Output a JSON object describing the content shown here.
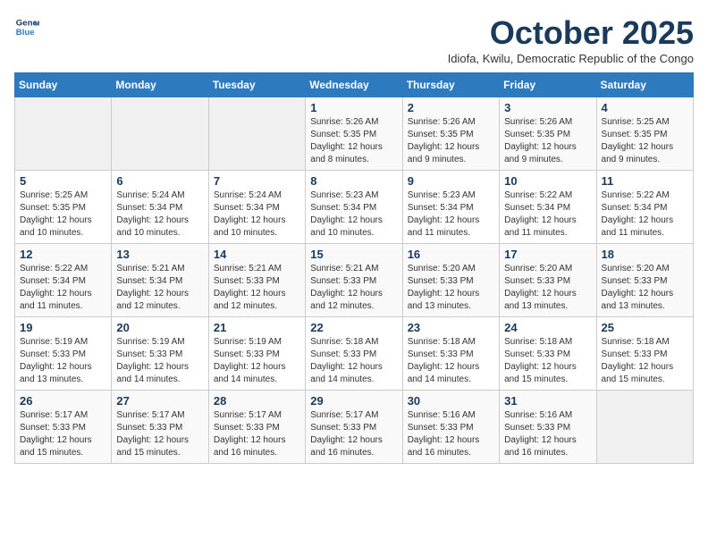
{
  "header": {
    "logo_line1": "General",
    "logo_line2": "Blue",
    "month_title": "October 2025",
    "subtitle": "Idiofa, Kwilu, Democratic Republic of the Congo"
  },
  "weekdays": [
    "Sunday",
    "Monday",
    "Tuesday",
    "Wednesday",
    "Thursday",
    "Friday",
    "Saturday"
  ],
  "weeks": [
    [
      {
        "day": "",
        "info": ""
      },
      {
        "day": "",
        "info": ""
      },
      {
        "day": "",
        "info": ""
      },
      {
        "day": "1",
        "info": "Sunrise: 5:26 AM\nSunset: 5:35 PM\nDaylight: 12 hours and 8 minutes."
      },
      {
        "day": "2",
        "info": "Sunrise: 5:26 AM\nSunset: 5:35 PM\nDaylight: 12 hours and 9 minutes."
      },
      {
        "day": "3",
        "info": "Sunrise: 5:26 AM\nSunset: 5:35 PM\nDaylight: 12 hours and 9 minutes."
      },
      {
        "day": "4",
        "info": "Sunrise: 5:25 AM\nSunset: 5:35 PM\nDaylight: 12 hours and 9 minutes."
      }
    ],
    [
      {
        "day": "5",
        "info": "Sunrise: 5:25 AM\nSunset: 5:35 PM\nDaylight: 12 hours and 10 minutes."
      },
      {
        "day": "6",
        "info": "Sunrise: 5:24 AM\nSunset: 5:34 PM\nDaylight: 12 hours and 10 minutes."
      },
      {
        "day": "7",
        "info": "Sunrise: 5:24 AM\nSunset: 5:34 PM\nDaylight: 12 hours and 10 minutes."
      },
      {
        "day": "8",
        "info": "Sunrise: 5:23 AM\nSunset: 5:34 PM\nDaylight: 12 hours and 10 minutes."
      },
      {
        "day": "9",
        "info": "Sunrise: 5:23 AM\nSunset: 5:34 PM\nDaylight: 12 hours and 11 minutes."
      },
      {
        "day": "10",
        "info": "Sunrise: 5:22 AM\nSunset: 5:34 PM\nDaylight: 12 hours and 11 minutes."
      },
      {
        "day": "11",
        "info": "Sunrise: 5:22 AM\nSunset: 5:34 PM\nDaylight: 12 hours and 11 minutes."
      }
    ],
    [
      {
        "day": "12",
        "info": "Sunrise: 5:22 AM\nSunset: 5:34 PM\nDaylight: 12 hours and 11 minutes."
      },
      {
        "day": "13",
        "info": "Sunrise: 5:21 AM\nSunset: 5:34 PM\nDaylight: 12 hours and 12 minutes."
      },
      {
        "day": "14",
        "info": "Sunrise: 5:21 AM\nSunset: 5:33 PM\nDaylight: 12 hours and 12 minutes."
      },
      {
        "day": "15",
        "info": "Sunrise: 5:21 AM\nSunset: 5:33 PM\nDaylight: 12 hours and 12 minutes."
      },
      {
        "day": "16",
        "info": "Sunrise: 5:20 AM\nSunset: 5:33 PM\nDaylight: 12 hours and 13 minutes."
      },
      {
        "day": "17",
        "info": "Sunrise: 5:20 AM\nSunset: 5:33 PM\nDaylight: 12 hours and 13 minutes."
      },
      {
        "day": "18",
        "info": "Sunrise: 5:20 AM\nSunset: 5:33 PM\nDaylight: 12 hours and 13 minutes."
      }
    ],
    [
      {
        "day": "19",
        "info": "Sunrise: 5:19 AM\nSunset: 5:33 PM\nDaylight: 12 hours and 13 minutes."
      },
      {
        "day": "20",
        "info": "Sunrise: 5:19 AM\nSunset: 5:33 PM\nDaylight: 12 hours and 14 minutes."
      },
      {
        "day": "21",
        "info": "Sunrise: 5:19 AM\nSunset: 5:33 PM\nDaylight: 12 hours and 14 minutes."
      },
      {
        "day": "22",
        "info": "Sunrise: 5:18 AM\nSunset: 5:33 PM\nDaylight: 12 hours and 14 minutes."
      },
      {
        "day": "23",
        "info": "Sunrise: 5:18 AM\nSunset: 5:33 PM\nDaylight: 12 hours and 14 minutes."
      },
      {
        "day": "24",
        "info": "Sunrise: 5:18 AM\nSunset: 5:33 PM\nDaylight: 12 hours and 15 minutes."
      },
      {
        "day": "25",
        "info": "Sunrise: 5:18 AM\nSunset: 5:33 PM\nDaylight: 12 hours and 15 minutes."
      }
    ],
    [
      {
        "day": "26",
        "info": "Sunrise: 5:17 AM\nSunset: 5:33 PM\nDaylight: 12 hours and 15 minutes."
      },
      {
        "day": "27",
        "info": "Sunrise: 5:17 AM\nSunset: 5:33 PM\nDaylight: 12 hours and 15 minutes."
      },
      {
        "day": "28",
        "info": "Sunrise: 5:17 AM\nSunset: 5:33 PM\nDaylight: 12 hours and 16 minutes."
      },
      {
        "day": "29",
        "info": "Sunrise: 5:17 AM\nSunset: 5:33 PM\nDaylight: 12 hours and 16 minutes."
      },
      {
        "day": "30",
        "info": "Sunrise: 5:16 AM\nSunset: 5:33 PM\nDaylight: 12 hours and 16 minutes."
      },
      {
        "day": "31",
        "info": "Sunrise: 5:16 AM\nSunset: 5:33 PM\nDaylight: 12 hours and 16 minutes."
      },
      {
        "day": "",
        "info": ""
      }
    ]
  ]
}
